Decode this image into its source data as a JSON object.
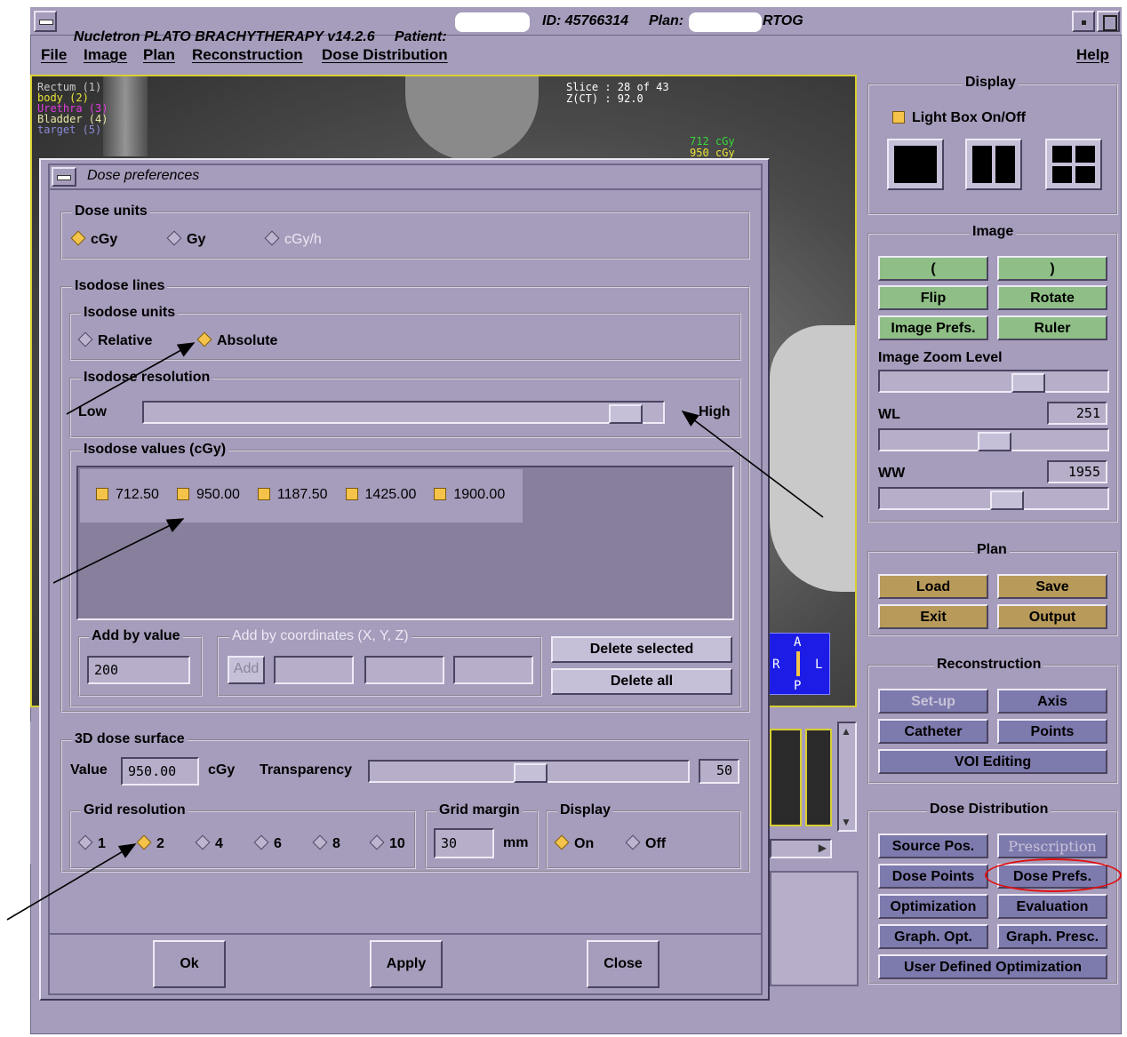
{
  "window": {
    "title": "Nucletron PLATO BRACHYTHERAPY v14.2.6",
    "patient_label": "Patient:",
    "id_label": "ID: 45766314",
    "plan_label": "Plan:",
    "plan_suffix": "RTOG"
  },
  "menu": {
    "file": "File",
    "image": "Image",
    "plan": "Plan",
    "reconstruction": "Reconstruction",
    "dose_distribution": "Dose Distribution",
    "help": "Help"
  },
  "ct": {
    "structures": [
      {
        "label": "Rectum (1)",
        "color": "#c9c9c9"
      },
      {
        "label": "body (2)",
        "color": "#e8e43a"
      },
      {
        "label": "Urethra (3)",
        "color": "#e23be2"
      },
      {
        "label": "Bladder (4)",
        "color": "#e8e8a8"
      },
      {
        "label": "target (5)",
        "color": "#8a8ad8"
      }
    ],
    "slice_text": "Slice : 28 of 43",
    "z_text": "Z(CT) : 92.0",
    "isodose_labels": [
      {
        "label": "712 cGy",
        "color": "#38d838"
      },
      {
        "label": "950 cGy",
        "color": "#e8e43a"
      }
    ],
    "orientation": {
      "a": "A",
      "r": "R",
      "l": "L",
      "p": "P"
    }
  },
  "display_panel": {
    "title": "Display",
    "lightbox_label": "Light Box On/Off"
  },
  "image_panel": {
    "title": "Image",
    "prev_label": "(",
    "next_label": ")",
    "flip": "Flip",
    "rotate": "Rotate",
    "image_prefs": "Image Prefs.",
    "ruler": "Ruler",
    "zoom_label": "Image Zoom Level",
    "zoom_level": 0.6,
    "wl_label": "WL",
    "wl_value": "251",
    "ww_label": "WW",
    "ww_value": "1955"
  },
  "plan_panel": {
    "title": "Plan",
    "load": "Load",
    "save": "Save",
    "exit": "Exit",
    "output": "Output"
  },
  "recon_panel": {
    "title": "Reconstruction",
    "setup": "Set-up",
    "axis": "Axis",
    "catheter": "Catheter",
    "points": "Points",
    "voi": "VOI Editing"
  },
  "dose_panel": {
    "title": "Dose Distribution",
    "source_pos": "Source Pos.",
    "prescription": "Prescription",
    "dose_points": "Dose Points",
    "dose_prefs": "Dose Prefs.",
    "optimization": "Optimization",
    "evaluation": "Evaluation",
    "graph_opt": "Graph. Opt.",
    "graph_presc": "Graph. Presc.",
    "user_defined": "User Defined Optimization"
  },
  "dialog": {
    "title": "Dose preferences",
    "dose_units": {
      "label": "Dose units",
      "cgy": "cGy",
      "gy": "Gy",
      "cgyh": "cGy/h",
      "selected": "cGy"
    },
    "isodose_lines_label": "Isodose lines",
    "isodose_units": {
      "label": "Isodose units",
      "relative": "Relative",
      "absolute": "Absolute",
      "selected": "Absolute"
    },
    "isodose_resolution": {
      "label": "Isodose resolution",
      "low": "Low",
      "high": "High",
      "level": 0.95
    },
    "isodose_values": {
      "label": "Isodose values (cGy)",
      "values": [
        "712.50",
        "950.00",
        "1187.50",
        "1425.00",
        "1900.00"
      ]
    },
    "add_by_value": {
      "label": "Add by value",
      "value": "200"
    },
    "add_by_coords": {
      "label": "Add by coordinates (X, Y, Z)",
      "add_button": "Add"
    },
    "delete_selected": "Delete selected",
    "delete_all": "Delete all",
    "surface": {
      "label": "3D dose surface",
      "value_label": "Value",
      "value": "950.00",
      "unit": "cGy",
      "transparency_label": "Transparency",
      "transparency": "50"
    },
    "grid_resolution": {
      "label": "Grid resolution",
      "options": [
        "1",
        "2",
        "4",
        "6",
        "8",
        "10"
      ],
      "selected": "2"
    },
    "grid_margin": {
      "label": "Grid margin",
      "value": "30",
      "unit": "mm"
    },
    "display": {
      "label": "Display",
      "on": "On",
      "off": "Off",
      "selected": "On"
    },
    "ok": "Ok",
    "apply": "Apply",
    "close": "Close"
  }
}
